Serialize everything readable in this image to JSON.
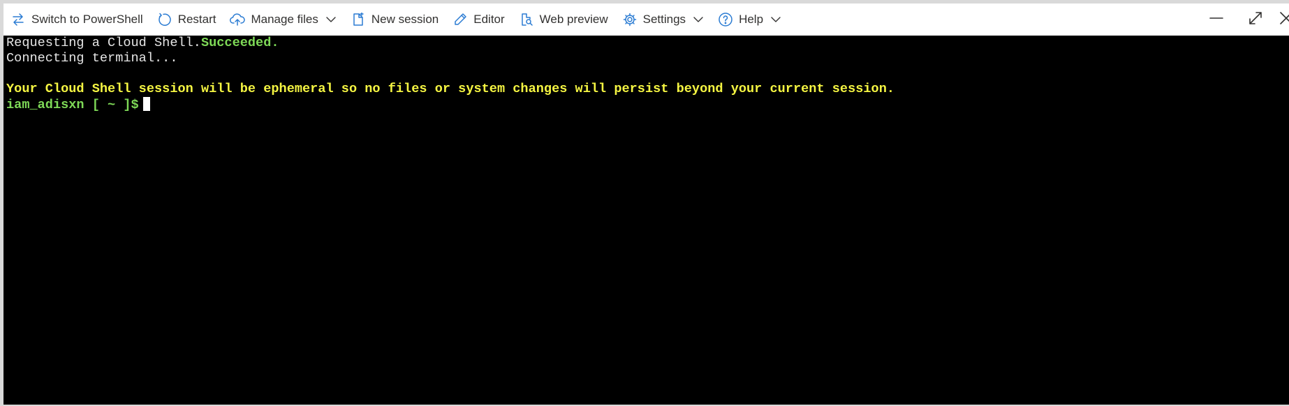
{
  "toolbar": {
    "switch_shell": "Switch to PowerShell",
    "restart": "Restart",
    "manage_files": "Manage files",
    "new_session": "New session",
    "editor": "Editor",
    "web_preview": "Web preview",
    "settings": "Settings",
    "help": "Help",
    "accent_color": "#2b7cd3"
  },
  "window_controls": {
    "minimize": "minimize-icon",
    "maximize": "maximize-icon",
    "close": "close-icon"
  },
  "terminal": {
    "line1_prefix": "Requesting a Cloud Shell.",
    "line1_status": "Succeeded.",
    "line2": "Connecting terminal...",
    "line3": "",
    "warning": "Your Cloud Shell session will be ephemeral so no files or system changes will persist beyond your current session.",
    "prompt": "iam_adisxn [ ~ ]$",
    "colors": {
      "background": "#000000",
      "text": "#e6e6e6",
      "success": "#7ed957",
      "warning": "#f5f542"
    }
  }
}
